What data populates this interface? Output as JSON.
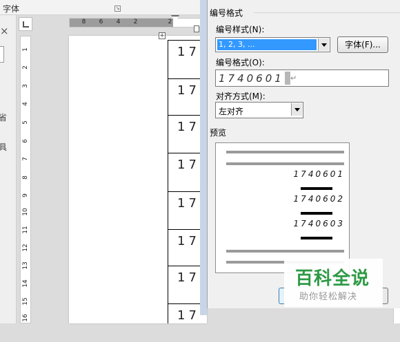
{
  "word": {
    "ribbon_group_label": "字体",
    "pane_chars": [
      "省",
      "具"
    ],
    "ruler_top_ticks": [
      "8",
      "6",
      "4",
      "2",
      "",
      "2"
    ],
    "ruler_left_ticks": [
      "1",
      "2",
      "3",
      "4",
      "5",
      "6",
      "7",
      "8",
      "9",
      "10",
      "11",
      "12",
      "13",
      "14",
      "15",
      "16"
    ],
    "table_cells": [
      "17",
      "17",
      "17",
      "17",
      "17",
      "17",
      "17",
      "17"
    ]
  },
  "dialog": {
    "group_title": "编号格式",
    "style_label": "编号样式(N):",
    "style_value": "1, 2, 3, ...",
    "font_button": "字体(F)...",
    "format_label": "编号格式(O):",
    "format_value": "1740601",
    "format_mark": "↵",
    "align_label": "对齐方式(M):",
    "align_value": "左对齐",
    "preview_label": "预览",
    "preview_numbers": [
      "1740601",
      "1740602",
      "1740603"
    ]
  },
  "watermark": {
    "title": "百科全说",
    "subtitle": "助你轻松解决"
  },
  "colors": {
    "selection": "#3399ff",
    "watermark_green": "#2e9a45"
  }
}
